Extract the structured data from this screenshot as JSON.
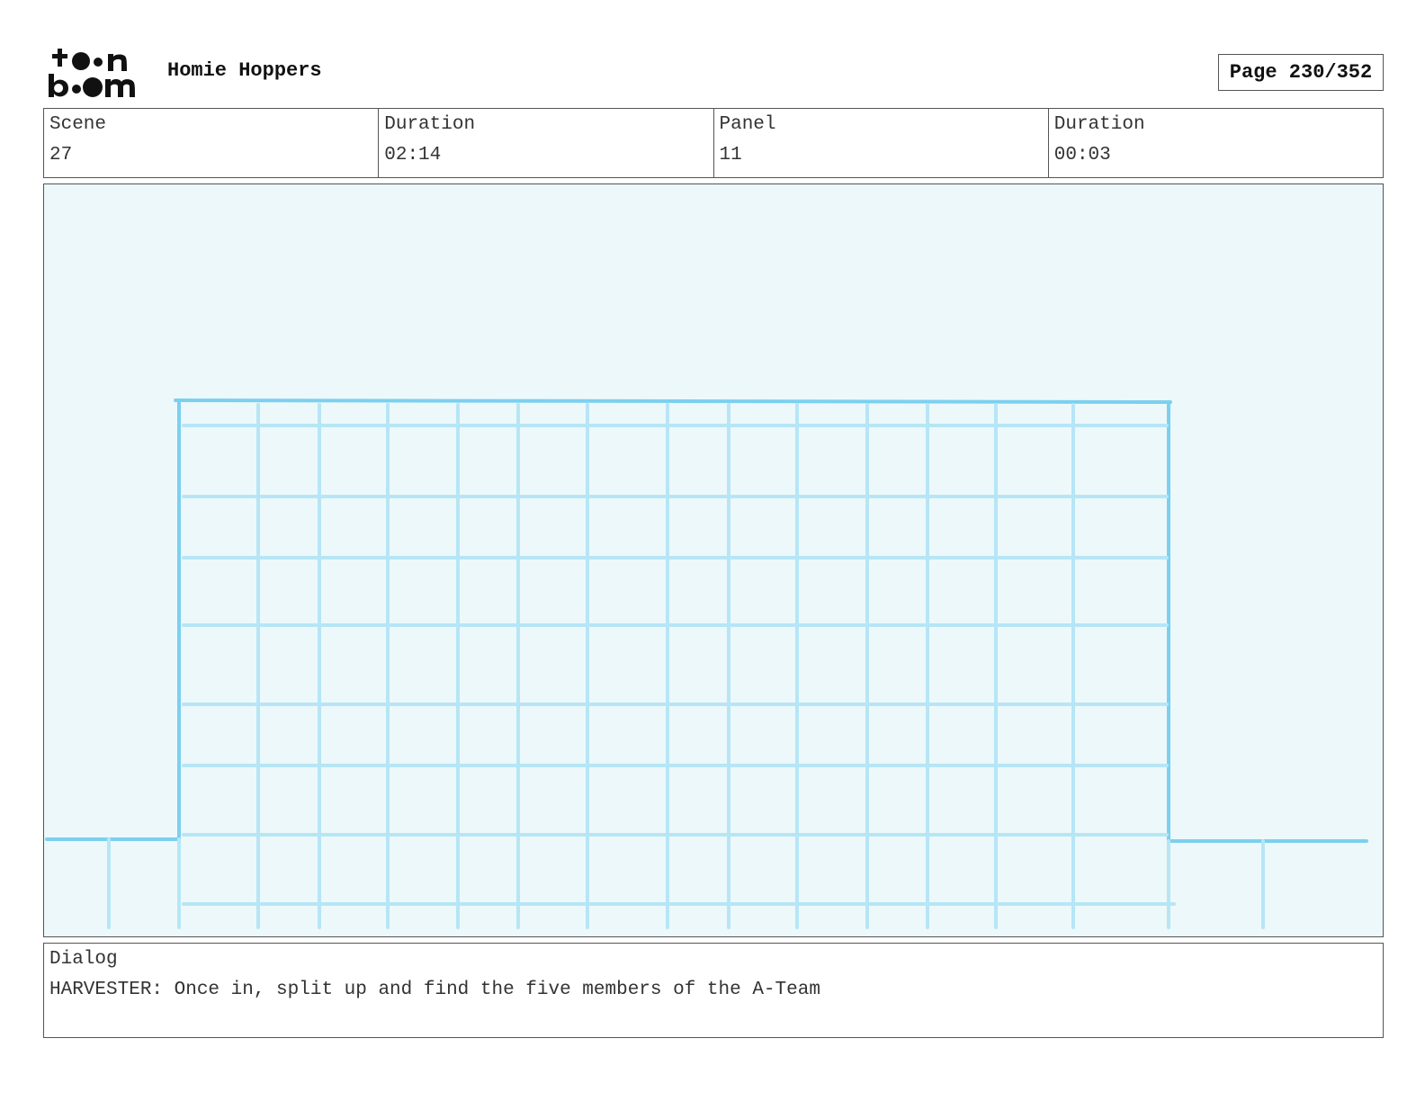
{
  "header": {
    "logo_text": "toon boom",
    "project_title": "Homie Hoppers",
    "page_label": "Page 230/352"
  },
  "info": {
    "scene_label": "Scene",
    "scene_value": "27",
    "scene_duration_label": "Duration",
    "scene_duration_value": "02:14",
    "panel_label": "Panel",
    "panel_value": "11",
    "panel_duration_label": "Duration",
    "panel_duration_value": "00:03"
  },
  "panel": {
    "background_color": "#edf8fb",
    "line_color": "#7cd0ef",
    "light_line_color": "#b6e6f6"
  },
  "dialog": {
    "label": "Dialog",
    "text": "HARVESTER: Once in, split up and find the five members of the A-Team"
  }
}
